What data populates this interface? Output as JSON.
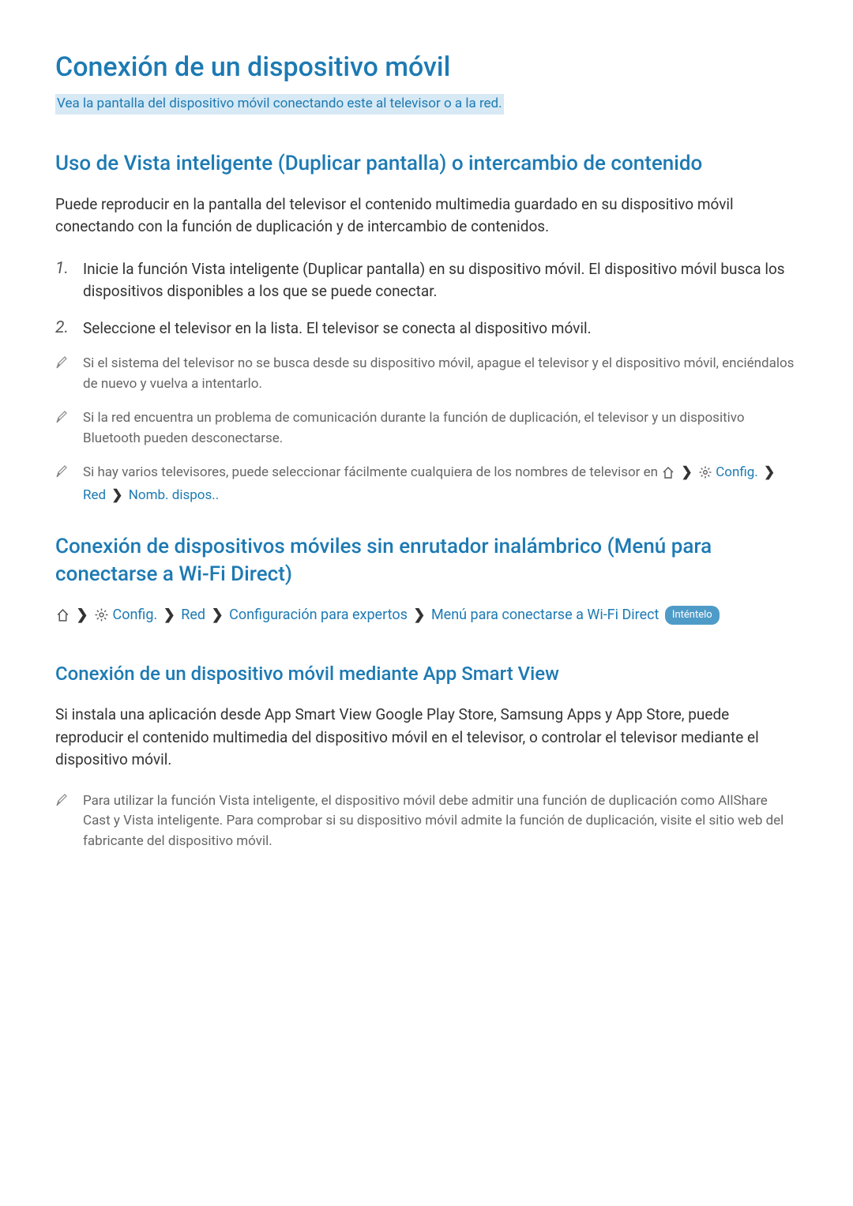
{
  "title": "Conexión de un dispositivo móvil",
  "subtitle": "Vea la pantalla del dispositivo móvil conectando este al televisor o a la red.",
  "section1": {
    "heading": "Uso de Vista inteligente (Duplicar pantalla) o intercambio de contenido",
    "intro": "Puede reproducir en la pantalla del televisor el contenido multimedia guardado en su dispositivo móvil conectando con la función de duplicación y de intercambio de contenidos.",
    "steps": [
      "Inicie la función Vista inteligente (Duplicar pantalla) en su dispositivo móvil. El dispositivo móvil busca los dispositivos disponibles a los que se puede conectar.",
      "Seleccione el televisor en la lista. El televisor se conecta al dispositivo móvil."
    ],
    "notes": [
      "Si el sistema del televisor no se busca desde su dispositivo móvil, apague el televisor y el dispositivo móvil, enciéndalos de nuevo y vuelva a intentarlo.",
      "Si la red encuentra un problema de comunicación durante la función de duplicación, el televisor y un dispositivo Bluetooth pueden desconectarse."
    ],
    "note3_prefix": "Si hay varios televisores, puede seleccionar fácilmente cualquiera de los nombres de televisor en ",
    "note3_crumbs": {
      "config": "Config.",
      "red": "Red",
      "nomb": "Nomb. dispos.."
    }
  },
  "section2": {
    "heading": "Conexión de dispositivos móviles sin enrutador inalámbrico (Menú para conectarse a Wi-Fi Direct)",
    "crumbs": {
      "config": "Config.",
      "red": "Red",
      "expertos": "Configuración para expertos",
      "menu": "Menú para conectarse a Wi-Fi Direct"
    },
    "badge": "Inténtelo"
  },
  "section3": {
    "heading": "Conexión de un dispositivo móvil mediante App Smart View",
    "intro": "Si instala una aplicación desde App Smart View Google Play Store, Samsung Apps y App Store, puede reproducir el contenido multimedia del dispositivo móvil en el televisor, o controlar el televisor mediante el dispositivo móvil.",
    "note": "Para utilizar la función Vista inteligente, el dispositivo móvil debe admitir una función de duplicación como AllShare Cast y Vista inteligente. Para comprobar si su dispositivo móvil admite la función de duplicación, visite el sitio web del fabricante del dispositivo móvil."
  }
}
